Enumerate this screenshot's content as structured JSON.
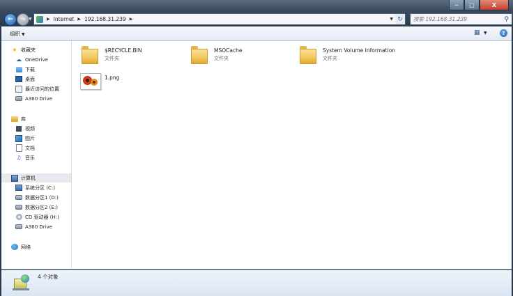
{
  "window": {
    "controls": {
      "minimize": "─",
      "maximize": "□",
      "close": "X"
    }
  },
  "address": {
    "segments": [
      "Internet",
      "192.168.31.239"
    ],
    "search_placeholder": "搜索 192.168.31.239"
  },
  "toolbar": {
    "organize_label": "组织"
  },
  "sidebar": {
    "favorites": {
      "header": "收藏夹",
      "items": [
        "OneDrive",
        "下载",
        "桌面",
        "最近访问的位置",
        "A360 Drive"
      ]
    },
    "libraries": {
      "header": "库",
      "items": [
        "视频",
        "图片",
        "文档",
        "音乐"
      ]
    },
    "computer": {
      "header": "计算机",
      "items": [
        "系统分区 (C:)",
        "数据分区1 (D:)",
        "数据分区2 (E:)",
        "CD 驱动器 (H:)",
        "A360 Drive"
      ]
    },
    "network": {
      "header": "网络"
    }
  },
  "files": [
    {
      "name": "$RECYCLE.BIN",
      "type": "文件夹"
    },
    {
      "name": "MSOCache",
      "type": "文件夹"
    },
    {
      "name": "System Volume Information",
      "type": "文件夹"
    },
    {
      "name": "1.png",
      "type": ""
    }
  ],
  "status": {
    "text": "4 个对象"
  }
}
